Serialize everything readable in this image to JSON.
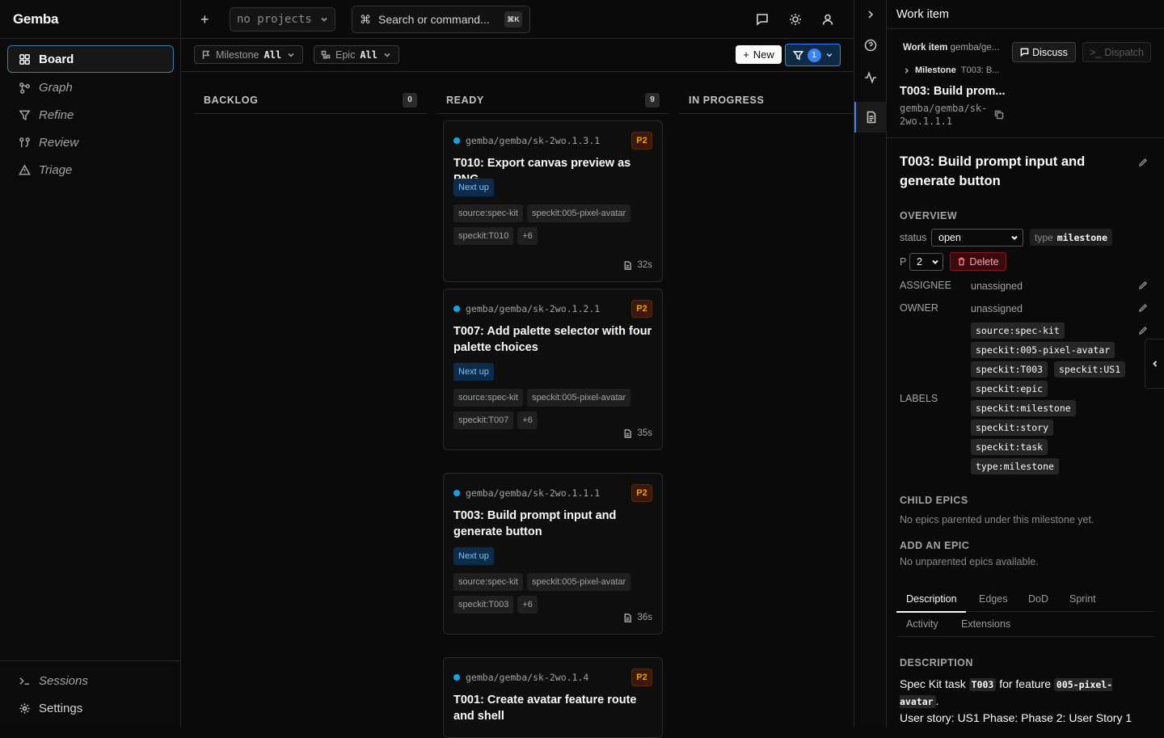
{
  "app": {
    "title": "Gemba"
  },
  "sidebar": {
    "items": [
      {
        "label": "Board",
        "icon": "grid-icon"
      },
      {
        "label": "Graph",
        "icon": "graph-icon"
      },
      {
        "label": "Refine",
        "icon": "filter-icon"
      },
      {
        "label": "Review",
        "icon": "review-icon"
      },
      {
        "label": "Triage",
        "icon": "warning-icon"
      }
    ],
    "bottom": [
      {
        "label": "Sessions",
        "icon": "terminal-icon"
      },
      {
        "label": "Settings",
        "icon": "gear-icon"
      }
    ]
  },
  "topbar": {
    "project_select": "no projects",
    "search_placeholder": "Search or command...",
    "shortcut": "⌘K"
  },
  "filters": {
    "milestone_label": "Milestone",
    "milestone_value": "All",
    "epic_label": "Epic",
    "epic_value": "All",
    "new_label": "New",
    "filter_count": "1"
  },
  "columns": [
    {
      "title": "BACKLOG",
      "count": "0"
    },
    {
      "title": "READY",
      "count": "9"
    },
    {
      "title": "IN PROGRESS"
    }
  ],
  "cards": [
    {
      "id": "gemba/gemba/sk-2wo.1.3.1",
      "priority": "P2",
      "title": "T010: Export canvas preview as PNG",
      "status": "Next up",
      "tags": [
        "source:spec-kit",
        "speckit:005-pixel-avatar",
        "speckit:T010",
        "+6"
      ],
      "time": "32s"
    },
    {
      "id": "gemba/gemba/sk-2wo.1.2.1",
      "priority": "P2",
      "title": "T007: Add palette selector with four palette choices",
      "status": "Next up",
      "tags": [
        "source:spec-kit",
        "speckit:005-pixel-avatar",
        "speckit:T007",
        "+6"
      ],
      "time": "35s"
    },
    {
      "id": "gemba/gemba/sk-2wo.1.1.1",
      "priority": "P2",
      "title": "T003: Build prompt input and generate button",
      "status": "Next up",
      "tags": [
        "source:spec-kit",
        "speckit:005-pixel-avatar",
        "speckit:T003",
        "+6"
      ],
      "time": "36s"
    },
    {
      "id": "gemba/gemba/sk-2wo.1.4",
      "priority": "P2",
      "title": "T001: Create avatar feature route and shell"
    }
  ],
  "panel": {
    "title": "Work item",
    "work_item_label": "Work item",
    "work_item_path": "gemba/ge...",
    "discuss_label": "Discuss",
    "dispatch_label": "Dispatch",
    "milestone_label": "Milestone",
    "milestone_value": "T003: B...",
    "short_title": "T003: Build prom...",
    "short_id": "gemba/gemba/sk-2wo.1.1.1",
    "full_title": "T003: Build prompt input and generate button",
    "overview_label": "OVERVIEW",
    "status_label": "status",
    "status_value": "open",
    "type_label": "type",
    "type_value": "milestone",
    "priority_label": "P",
    "priority_value": "2",
    "delete_label": "Delete",
    "assignee_label": "ASSIGNEE",
    "assignee_value": "unassigned",
    "owner_label": "OWNER",
    "owner_value": "unassigned",
    "labels_label": "LABELS",
    "labels": [
      "source:spec-kit",
      "speckit:005-pixel-avatar",
      "speckit:T003",
      "speckit:US1",
      "speckit:epic",
      "speckit:milestone",
      "speckit:story",
      "speckit:task",
      "type:milestone"
    ],
    "child_epics_label": "CHILD EPICS",
    "child_epics_text": "No epics parented under this milestone yet.",
    "add_epic_label": "ADD AN EPIC",
    "add_epic_text": "No unparented epics available.",
    "tabs": [
      "Description",
      "Edges",
      "DoD",
      "Sprint",
      "Activity",
      "Extensions"
    ],
    "description_label": "DESCRIPTION",
    "description": {
      "pre": "Spec Kit task",
      "code1": "T003",
      "mid": "for feature",
      "code2": "005-pixel-avatar",
      "post": ".",
      "line2": "User story: US1 Phase: Phase 2: User Story 1"
    }
  },
  "colors": {
    "accent": "#3b82f6",
    "priority": "#f59e0b",
    "status_bg": "#0c2c4a",
    "danger": "#f87171"
  }
}
